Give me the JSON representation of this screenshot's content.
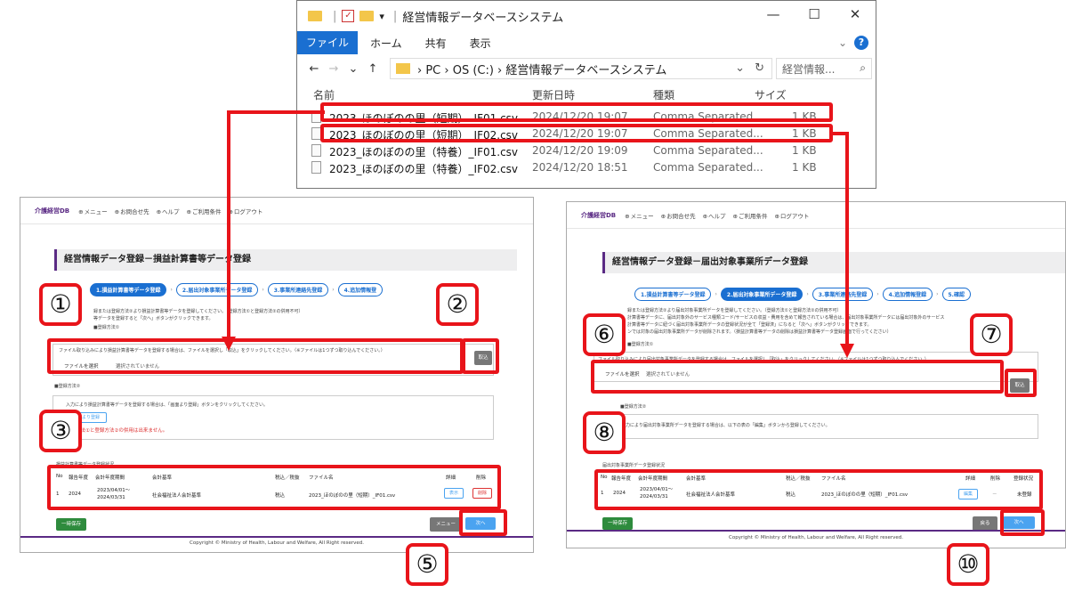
{
  "explorer": {
    "title": "経営情報データベースシステム",
    "quick_sep": "|",
    "qa_dropdown": "▾",
    "controls": {
      "minimize": "—",
      "maximize": "☐",
      "close": "✕"
    },
    "ribbon": {
      "file": "ファイル",
      "home": "ホーム",
      "share": "共有",
      "view": "表示",
      "chevron": "⌄",
      "help": "?"
    },
    "nav": {
      "back": "←",
      "forward": "→",
      "recent": "⌄",
      "up": "↑"
    },
    "address_path": "› PC › OS (C:) › 経営情報データベースシステム",
    "address_dropdown": "⌄",
    "refresh": "↻",
    "search_placeholder": "経営情報...",
    "search_icon": "⌕",
    "columns": {
      "name": "名前",
      "modified": "更新日時",
      "type": "種類",
      "size": "サイズ"
    },
    "files": [
      {
        "name": "2023_ほのぼのの里（短期）_IF01.csv",
        "modified": "2024/12/20 19:07",
        "type": "Comma Separated...",
        "size": "1 KB"
      },
      {
        "name": "2023_ほのぼのの里（短期）_IF02.csv",
        "modified": "2024/12/20 19:07",
        "type": "Comma Separated...",
        "size": "1 KB"
      },
      {
        "name": "2023_ほのぼのの里（特養）_IF01.csv",
        "modified": "2024/12/20 19:09",
        "type": "Comma Separated...",
        "size": "1 KB"
      },
      {
        "name": "2023_ほのぼのの里（特養）_IF02.csv",
        "modified": "2024/12/20 18:51",
        "type": "Comma Separated...",
        "size": "1 KB"
      }
    ]
  },
  "app": {
    "logo": "介護経営DB",
    "nav_links": [
      "メニュー",
      "お問合せ先",
      "ヘルプ",
      "ご利用条件",
      "ログアウト"
    ],
    "copyright": "Copyright © Ministry of Health, Labour and Welfare, All Right reserved."
  },
  "left_panel": {
    "heading": "経営情報データ登録－損益計算書等データ登録",
    "steps": [
      "1.損益計算書等データ登録",
      "2.届出対象事業所データ登録",
      "3.事業所連絡先登録",
      "4.追加情報登"
    ],
    "intro1": "録または登録方法②より損益計算書等データを登録してください。（登録方法①と登録方法②の併用不可）",
    "intro2": "等データを登録すると「次へ」ボタンがクリックできます。",
    "method1_label": "■登録方法①",
    "method1_text": "ファイル取り込みにより損益計算書等データを登録する場合は、ファイルを選択し「取込」をクリックしてください。（※ファイルは1つずつ取り込んでください。）",
    "file_choose": "ファイルを選択",
    "file_none": "選択されていません",
    "import_button": "取込",
    "method2_label": "■登録方法②",
    "method2_text": "入力により損益計算書等データを登録する場合は、「画面より登録」ボタンをクリックしてください。",
    "screen_register_button": "画面より登録",
    "warning": "登録方法①と登録方法②の併用は出来ません。",
    "table_title": "損益計算書等データ登録状況",
    "table_headers": [
      "No",
      "報告年度",
      "会計年度期間",
      "会計基準",
      "税込／税抜",
      "ファイル名",
      "詳細",
      "削除"
    ],
    "table_row": [
      "1",
      "2024",
      "2023/04/01～",
      "2024/03/31",
      "社会福祉法人会計基準",
      "税込",
      "2023_ほのぼのの里（短期）_IF01.csv"
    ],
    "detail_button": "表示",
    "delete_button": "削除",
    "temp_save": "一時保存",
    "menu_button": "メニュー",
    "next_button": "次へ"
  },
  "right_panel": {
    "heading": "経営情報データ登録－届出対象事業所データ登録",
    "steps": [
      "1.損益計算書等データ登録",
      "2.届出対象事業所データ登録",
      "3.事業所連絡先登録",
      "4.追加情報登録",
      "5.確認"
    ],
    "intro1": "録または登録方法②より届出対象事業所データを登録してください。（登録方法①と登録方法②の併用不可）",
    "intro2": "計算書等データに、届出対象外のサービス種類コード/サービスの収益・費用を含めて報告されている場合は、届出対象事業所データには届出対象外のサービス",
    "intro3": "計算書等データに紐づく届出対象事業所データの登録状況が全て「登録済」になると「次へ」ボタンがクリックできます。",
    "intro4": "ンでは対象の届出対象事業所データが削除されます。（損益計算書等データの削除は損益計算書等データ登録画面で行ってください）",
    "method1_label": "■登録方法①",
    "method1_text": "ファイル取り込みにより届出対象事業所データを登録する場合は、ファイルを選択し「取込」をクリックしてください。（※ファイルは1つずつ取り込んでください。）",
    "file_choose": "ファイルを選択",
    "file_none": "選択されていません",
    "import_button": "取込",
    "method2_label": "■登録方法②",
    "method2_text": "入力により届出対象事業所データを登録する場合は、以下の表の「編集」ボタンから登録してください。",
    "table_title": "届出対象事業所データ登録状況",
    "table_headers": [
      "No",
      "報告年度",
      "会計年度期間",
      "会計基準",
      "税込／税抜",
      "ファイル名",
      "詳細",
      "削除",
      "登録状況"
    ],
    "table_row": [
      "1",
      "2024",
      "2023/04/01～",
      "2024/03/31",
      "社会福祉法人会計基準",
      "税込",
      "2023_ほのぼのの里（短期）_IF01.csv",
      "未登録"
    ],
    "edit_button": "編集",
    "delete_dash": "－",
    "temp_save": "一時保存",
    "back_button": "戻る",
    "next_button": "次へ"
  },
  "annotations": [
    "①",
    "②",
    "③",
    "⑤",
    "⑥",
    "⑦",
    "⑧",
    "⑩"
  ],
  "colors": {
    "highlight": "#e8141a",
    "brand": "#5a2a84",
    "primary": "#1a6fd1"
  }
}
